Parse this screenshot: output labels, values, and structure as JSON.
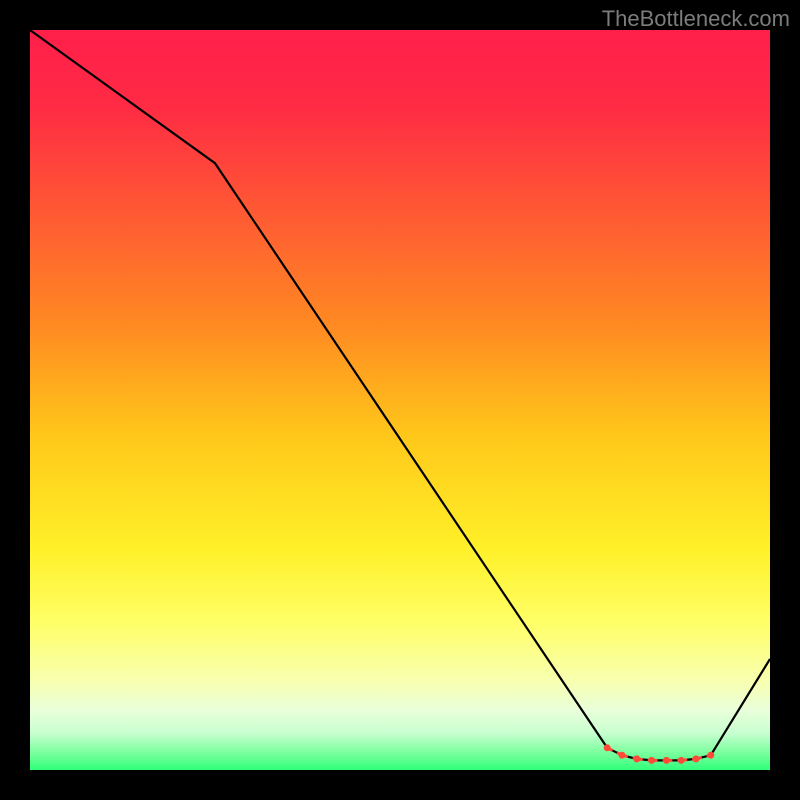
{
  "watermark": "TheBottleneck.com",
  "chart_data": {
    "type": "line",
    "title": "",
    "xlabel": "",
    "ylabel": "",
    "xlim": [
      0,
      100
    ],
    "ylim": [
      0,
      100
    ],
    "x": [
      0,
      25,
      78,
      80,
      82,
      84,
      86,
      88,
      90,
      92,
      100
    ],
    "values": [
      100,
      82,
      3,
      2,
      1.5,
      1.3,
      1.3,
      1.3,
      1.5,
      2,
      15
    ],
    "gradient_stops": [
      {
        "offset": 0.0,
        "color": "#ff1f4b"
      },
      {
        "offset": 0.1,
        "color": "#ff2a44"
      },
      {
        "offset": 0.25,
        "color": "#ff5a33"
      },
      {
        "offset": 0.4,
        "color": "#ff8a22"
      },
      {
        "offset": 0.55,
        "color": "#ffc81a"
      },
      {
        "offset": 0.7,
        "color": "#fff028"
      },
      {
        "offset": 0.8,
        "color": "#ffff66"
      },
      {
        "offset": 0.88,
        "color": "#f8ffb0"
      },
      {
        "offset": 0.92,
        "color": "#e8ffda"
      },
      {
        "offset": 0.95,
        "color": "#c8ffd0"
      },
      {
        "offset": 0.975,
        "color": "#7fffa0"
      },
      {
        "offset": 1.0,
        "color": "#2fff7a"
      }
    ],
    "marker_indices": [
      2,
      3,
      4,
      5,
      6,
      7,
      8,
      9
    ],
    "marker_color": "#ff4a3a",
    "line_color": "#000000"
  }
}
